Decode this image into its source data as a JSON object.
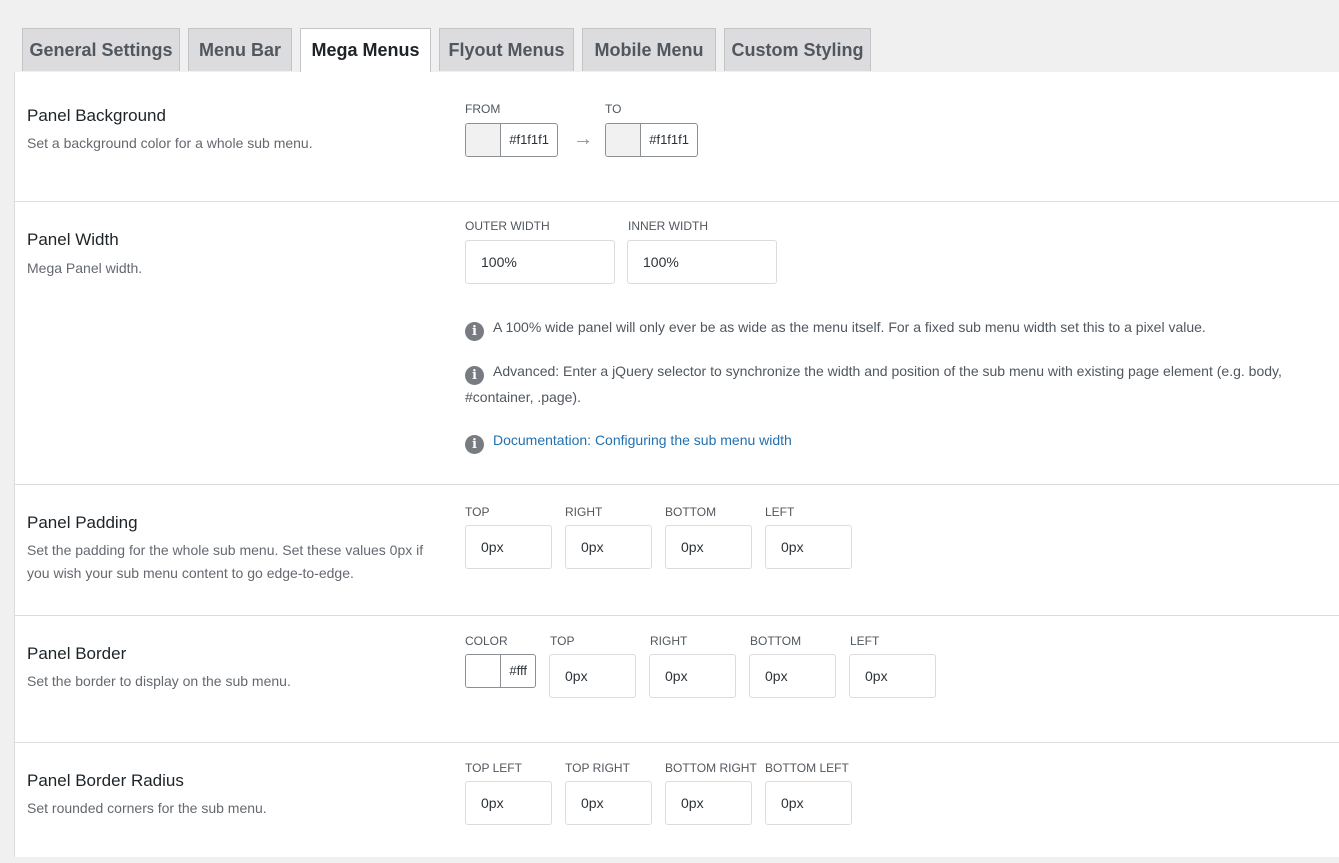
{
  "tabs": [
    {
      "label": "General Settings",
      "active": false
    },
    {
      "label": "Menu Bar",
      "active": false
    },
    {
      "label": "Mega Menus",
      "active": true
    },
    {
      "label": "Flyout Menus",
      "active": false
    },
    {
      "label": "Mobile Menu",
      "active": false
    },
    {
      "label": "Custom Styling",
      "active": false
    }
  ],
  "panel_background": {
    "title": "Panel Background",
    "description": "Set a background color for a whole sub menu.",
    "from_label": "FROM",
    "from_color": "#f1f1f1",
    "arrow_icon": "arrow-right-icon",
    "to_label": "TO",
    "to_color": "#f1f1f1"
  },
  "panel_width": {
    "title": "Panel Width",
    "description": "Mega Panel width.",
    "outer_label": "OUTER WIDTH",
    "outer_value": "100%",
    "inner_label": "INNER WIDTH",
    "inner_value": "100%",
    "info1": "A 100% wide panel will only ever be as wide as the menu itself. For a fixed sub menu width set this to a pixel value.",
    "info2": "Advanced: Enter a jQuery selector to synchronize the width and position of the sub menu with existing page element (e.g. body, #container, .page).",
    "doc_link": "Documentation: Configuring the sub menu width",
    "info_icon": "info-icon"
  },
  "panel_padding": {
    "title": "Panel Padding",
    "description": "Set the padding for the whole sub menu. Set these values 0px if you wish your sub menu content to go edge-to-edge.",
    "top_label": "TOP",
    "top_value": "0px",
    "right_label": "RIGHT",
    "right_value": "0px",
    "bottom_label": "BOTTOM",
    "bottom_value": "0px",
    "left_label": "LEFT",
    "left_value": "0px"
  },
  "panel_border": {
    "title": "Panel Border",
    "description": "Set the border to display on the sub menu.",
    "color_label": "COLOR",
    "color_value": "#fff",
    "top_label": "TOP",
    "top_value": "0px",
    "right_label": "RIGHT",
    "right_value": "0px",
    "bottom_label": "BOTTOM",
    "bottom_value": "0px",
    "left_label": "LEFT",
    "left_value": "0px"
  },
  "panel_border_radius": {
    "title": "Panel Border Radius",
    "description": "Set rounded corners for the sub menu.",
    "tl_label": "TOP LEFT",
    "tl_value": "0px",
    "tr_label": "TOP RIGHT",
    "tr_value": "0px",
    "br_label": "BOTTOM RIGHT",
    "br_value": "0px",
    "bl_label": "BOTTOM LEFT",
    "bl_value": "0px"
  }
}
